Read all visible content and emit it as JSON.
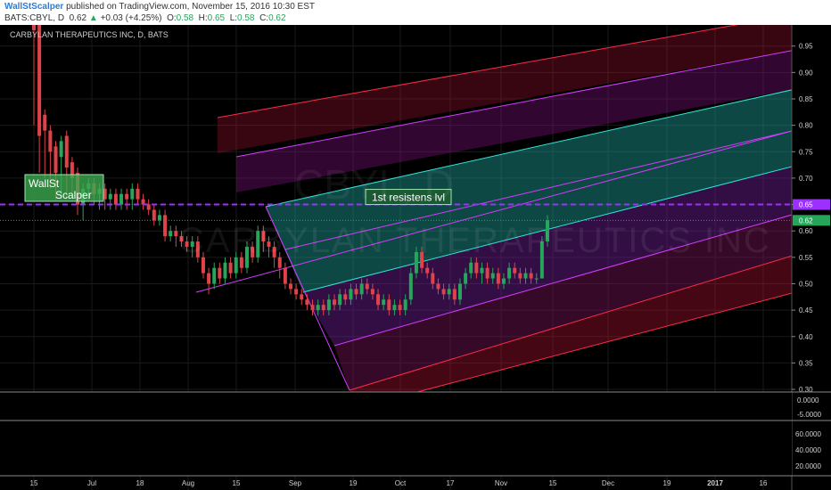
{
  "header": {
    "author": "WallStScalper",
    "published": "published on TradingView.com, November 15, 2016 10:30 EST",
    "symbol": "BATS:CBYL, D",
    "last": "0.62",
    "change": "+0.03 (+4.25%)",
    "o_label": "O:",
    "o_value": "0.58",
    "h_label": "H:",
    "h_value": "0.65",
    "l_label": "L:",
    "l_value": "0.58",
    "c_label": "C:",
    "c_value": "0.62"
  },
  "subtitle": "CARBYLAN THERAPEUTICS INC, D, BATS",
  "watermark": {
    "symbol": "CBYL, D",
    "name": "CARBYLAN THERAPEUTICS INC"
  },
  "annotations": {
    "logo_line1": "WallSt",
    "logo_line2": "Scalper",
    "resistance_label": "1st resistens lvl"
  },
  "price_badges": {
    "resistance": "0.65",
    "last": "0.62"
  },
  "colors": {
    "background": "#000000",
    "up": "#26a65b",
    "down": "#e0424a",
    "resistance": "#9b30ff",
    "fork_cyan": "#2ee6d6",
    "fork_magenta": "#d63cff",
    "fork_red": "#ff2a4a"
  },
  "chart_data": {
    "type": "candlestick",
    "x_ticks": [
      "15",
      "Jul",
      "18",
      "Aug",
      "15",
      "Sep",
      "19",
      "Oct",
      "17",
      "Nov",
      "15",
      "Dec",
      "19",
      "2017",
      "16"
    ],
    "y_ticks": [
      "0.95",
      "0.90",
      "0.85",
      "0.80",
      "0.75",
      "0.70",
      "0.65",
      "0.60",
      "0.55",
      "0.50",
      "0.45",
      "0.40",
      "0.35",
      "0.30"
    ],
    "ylim": [
      0.295,
      0.99
    ],
    "horizontal_line": 0.65,
    "indicator_panel_1_ticks": [
      "0.0000",
      "-5.0000"
    ],
    "indicator_panel_2_ticks": [
      "60.0000",
      "40.0000",
      "20.0000"
    ],
    "candles": [
      [
        1.0,
        0.98,
        0.8
      ],
      [
        0.99,
        0.78,
        0.71
      ],
      [
        0.82,
        0.79,
        0.7
      ],
      [
        0.79,
        0.75,
        0.68
      ],
      [
        0.76,
        0.71,
        0.66
      ],
      [
        0.74,
        0.77,
        0.66
      ],
      [
        0.78,
        0.72,
        0.66
      ],
      [
        0.73,
        0.7,
        0.67
      ],
      [
        0.71,
        0.65,
        0.63
      ],
      [
        0.65,
        0.68,
        0.62
      ],
      [
        0.68,
        0.69,
        0.66
      ],
      [
        0.69,
        0.67,
        0.65
      ],
      [
        0.67,
        0.68,
        0.64
      ],
      [
        0.68,
        0.66,
        0.64
      ],
      [
        0.66,
        0.67,
        0.64
      ],
      [
        0.67,
        0.65,
        0.64
      ],
      [
        0.65,
        0.67,
        0.64
      ],
      [
        0.67,
        0.66,
        0.64
      ],
      [
        0.66,
        0.68,
        0.64
      ],
      [
        0.68,
        0.66,
        0.65
      ],
      [
        0.66,
        0.65,
        0.64
      ],
      [
        0.65,
        0.64,
        0.63
      ],
      [
        0.64,
        0.62,
        0.61
      ],
      [
        0.62,
        0.63,
        0.61
      ],
      [
        0.63,
        0.59,
        0.58
      ],
      [
        0.59,
        0.6,
        0.58
      ],
      [
        0.6,
        0.59,
        0.57
      ],
      [
        0.59,
        0.58,
        0.57
      ],
      [
        0.58,
        0.57,
        0.56
      ],
      [
        0.57,
        0.58,
        0.55
      ],
      [
        0.58,
        0.55,
        0.54
      ],
      [
        0.55,
        0.52,
        0.51
      ],
      [
        0.52,
        0.5,
        0.48
      ],
      [
        0.5,
        0.53,
        0.49
      ],
      [
        0.53,
        0.51,
        0.5
      ],
      [
        0.51,
        0.54,
        0.5
      ],
      [
        0.54,
        0.52,
        0.51
      ],
      [
        0.52,
        0.55,
        0.51
      ],
      [
        0.55,
        0.53,
        0.52
      ],
      [
        0.53,
        0.57,
        0.52
      ],
      [
        0.57,
        0.55,
        0.54
      ],
      [
        0.55,
        0.6,
        0.54
      ],
      [
        0.6,
        0.58,
        0.56
      ],
      [
        0.58,
        0.57,
        0.55
      ],
      [
        0.57,
        0.55,
        0.53
      ],
      [
        0.55,
        0.53,
        0.51
      ],
      [
        0.53,
        0.5,
        0.49
      ],
      [
        0.5,
        0.49,
        0.48
      ],
      [
        0.49,
        0.48,
        0.47
      ],
      [
        0.48,
        0.47,
        0.46
      ],
      [
        0.47,
        0.46,
        0.45
      ],
      [
        0.46,
        0.45,
        0.44
      ],
      [
        0.45,
        0.46,
        0.44
      ],
      [
        0.46,
        0.45,
        0.44
      ],
      [
        0.45,
        0.47,
        0.44
      ],
      [
        0.47,
        0.46,
        0.45
      ],
      [
        0.46,
        0.48,
        0.45
      ],
      [
        0.48,
        0.47,
        0.46
      ],
      [
        0.47,
        0.49,
        0.46
      ],
      [
        0.49,
        0.48,
        0.47
      ],
      [
        0.48,
        0.5,
        0.47
      ],
      [
        0.5,
        0.49,
        0.48
      ],
      [
        0.49,
        0.48,
        0.47
      ],
      [
        0.48,
        0.46,
        0.45
      ],
      [
        0.46,
        0.47,
        0.45
      ],
      [
        0.47,
        0.45,
        0.44
      ],
      [
        0.45,
        0.46,
        0.44
      ],
      [
        0.46,
        0.45,
        0.44
      ],
      [
        0.45,
        0.47,
        0.44
      ],
      [
        0.47,
        0.52,
        0.46
      ],
      [
        0.52,
        0.56,
        0.51
      ],
      [
        0.56,
        0.53,
        0.52
      ],
      [
        0.53,
        0.52,
        0.51
      ],
      [
        0.52,
        0.5,
        0.49
      ],
      [
        0.5,
        0.49,
        0.48
      ],
      [
        0.49,
        0.48,
        0.47
      ],
      [
        0.48,
        0.49,
        0.47
      ],
      [
        0.49,
        0.47,
        0.46
      ],
      [
        0.47,
        0.5,
        0.46
      ],
      [
        0.5,
        0.52,
        0.49
      ],
      [
        0.52,
        0.54,
        0.51
      ],
      [
        0.54,
        0.52,
        0.51
      ],
      [
        0.52,
        0.53,
        0.5
      ],
      [
        0.53,
        0.51,
        0.5
      ],
      [
        0.51,
        0.52,
        0.5
      ],
      [
        0.52,
        0.5,
        0.49
      ],
      [
        0.5,
        0.51,
        0.49
      ],
      [
        0.51,
        0.53,
        0.5
      ],
      [
        0.53,
        0.52,
        0.51
      ],
      [
        0.52,
        0.51,
        0.5
      ],
      [
        0.51,
        0.52,
        0.5
      ],
      [
        0.52,
        0.51,
        0.5
      ],
      [
        0.51,
        0.51,
        0.5
      ],
      [
        0.51,
        0.58,
        0.51
      ],
      [
        0.58,
        0.62,
        0.57
      ]
    ]
  }
}
